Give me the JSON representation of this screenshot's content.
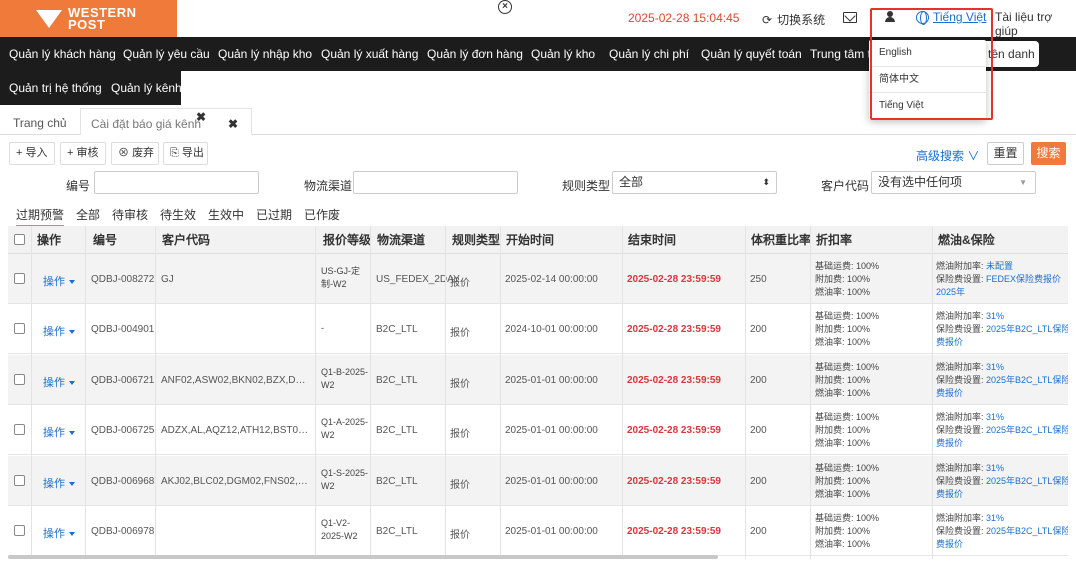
{
  "brand": {
    "logo_text_line1": "WESTERN",
    "logo_text_line2": "POST",
    "accent": "#f07a3a"
  },
  "header": {
    "close_icon": "x-circle-icon",
    "datetime": "2025-02-28 15:04:45",
    "switch_system": "切换系统",
    "language_current": "Tiếng Việt",
    "help": "Tài liệu trợ giúp"
  },
  "nav": {
    "row1": [
      "Quản lý khách hàng",
      "Quản lý yêu cầu",
      "Quản lý nhập kho",
      "Quản lý xuất hàng",
      "Quản lý đơn hàng",
      "Quản lý kho",
      "Quản lý chi phí",
      "Quản lý quyết toán",
      "Trung tâm t"
    ],
    "row2": [
      "Quản trị hệ thống",
      "Quản lý kênh"
    ],
    "search_partial": "tên danh"
  },
  "language_menu": [
    "English",
    "简体中文",
    "Tiếng Việt"
  ],
  "tabs": {
    "home": "Trang chủ",
    "active": "Cài đặt báo giá kênh"
  },
  "toolbar": {
    "import": "导入",
    "review": "审核",
    "discard": "废弃",
    "export": "导出",
    "advanced": "高级搜索",
    "reset": "重置",
    "search": "搜索"
  },
  "filters": {
    "code_label": "编号",
    "code_value": "",
    "channel_label": "物流渠道",
    "channel_value": "",
    "rule_label": "规则类型",
    "rule_value": "全部",
    "customer_label": "客户代码",
    "customer_value": "没有选中任何项"
  },
  "status_tabs": [
    "过期预警",
    "全部",
    "待审核",
    "待生效",
    "生效中",
    "已过期",
    "已作废"
  ],
  "table": {
    "headers": [
      "操作",
      "编号",
      "客户代码",
      "报价等级",
      "物流渠道",
      "规则类型",
      "开始时间",
      "结束时间",
      "体积重比率",
      "折扣率",
      "燃油&保险"
    ],
    "op_label": "操作",
    "rows": [
      {
        "code": "QDBJ-008272",
        "customer": "GJ",
        "level": "US-GJ-定制-W2",
        "channel": "US_FEDEX_2DAY",
        "rule": "报价",
        "start": "2025-02-14 00:00:00",
        "end": "2025-02-28 23:59:59",
        "ratio": "250",
        "disc1": "基础运费: 100%",
        "disc2": "附加费: 100%",
        "disc3": "燃油率: 100%",
        "fuel1_label": "燃油附加率: ",
        "fuel1_val": "未配置",
        "fuel2_label": "保险费设置: ",
        "fuel2_val": "FEDEX保险费报价",
        "fuel3": "2025年"
      },
      {
        "code": "QDBJ-004901",
        "customer": "",
        "level": "-",
        "channel": "B2C_LTL",
        "rule": "报价",
        "start": "2024-10-01 00:00:00",
        "end": "2025-02-28 23:59:59",
        "ratio": "200",
        "disc1": "基础运费: 100%",
        "disc2": "附加费: 100%",
        "disc3": "燃油率: 100%",
        "fuel1_label": "燃油附加率: ",
        "fuel1_val": "31%",
        "fuel2_label": "保险费设置: ",
        "fuel2_val": "2025年B2C_LTL保险",
        "fuel3": "费报价"
      },
      {
        "code": "QDBJ-006721",
        "customer": "ANF02,ASW02,BKN02,BZX,DHH02...",
        "level": "Q1-B-2025-W2",
        "channel": "B2C_LTL",
        "rule": "报价",
        "start": "2025-01-01 00:00:00",
        "end": "2025-02-28 23:59:59",
        "ratio": "200",
        "disc1": "基础运费: 100%",
        "disc2": "附加费: 100%",
        "disc3": "燃油率: 100%",
        "fuel1_label": "燃油附加率: ",
        "fuel1_val": "31%",
        "fuel2_label": "保险费设置: ",
        "fuel2_val": "2025年B2C_LTL保险",
        "fuel3": "费报价"
      },
      {
        "code": "QDBJ-006725",
        "customer": "ADZX,AL,AQZ12,ATH12,BST02...",
        "level": "Q1-A-2025-W2",
        "channel": "B2C_LTL",
        "rule": "报价",
        "start": "2025-01-01 00:00:00",
        "end": "2025-02-28 23:59:59",
        "ratio": "200",
        "disc1": "基础运费: 100%",
        "disc2": "附加费: 100%",
        "disc3": "燃油率: 100%",
        "fuel1_label": "燃油附加率: ",
        "fuel1_val": "31%",
        "fuel2_label": "保险费设置: ",
        "fuel2_val": "2025年B2C_LTL保险",
        "fuel3": "费报价"
      },
      {
        "code": "QDBJ-006968",
        "customer": "AKJ02,BLC02,DGM02,FNS02,GLW12...",
        "level": "Q1-S-2025-W2",
        "channel": "B2C_LTL",
        "rule": "报价",
        "start": "2025-01-01 00:00:00",
        "end": "2025-02-28 23:59:59",
        "ratio": "200",
        "disc1": "基础运费: 100%",
        "disc2": "附加费: 100%",
        "disc3": "燃油率: 100%",
        "fuel1_label": "燃油附加率: ",
        "fuel1_val": "31%",
        "fuel2_label": "保险费设置: ",
        "fuel2_val": "2025年B2C_LTL保险",
        "fuel3": "费报价"
      },
      {
        "code": "QDBJ-006978",
        "customer": "",
        "level": "Q1-V2-2025-W2",
        "channel": "B2C_LTL",
        "rule": "报价",
        "start": "2025-01-01 00:00:00",
        "end": "2025-02-28 23:59:59",
        "ratio": "200",
        "disc1": "基础运费: 100%",
        "disc2": "附加费: 100%",
        "disc3": "燃油率: 100%",
        "fuel1_label": "燃油附加率: ",
        "fuel1_val": "31%",
        "fuel2_label": "保险费设置: ",
        "fuel2_val": "2025年B2C_LTL保险",
        "fuel3": "费报价"
      }
    ]
  }
}
